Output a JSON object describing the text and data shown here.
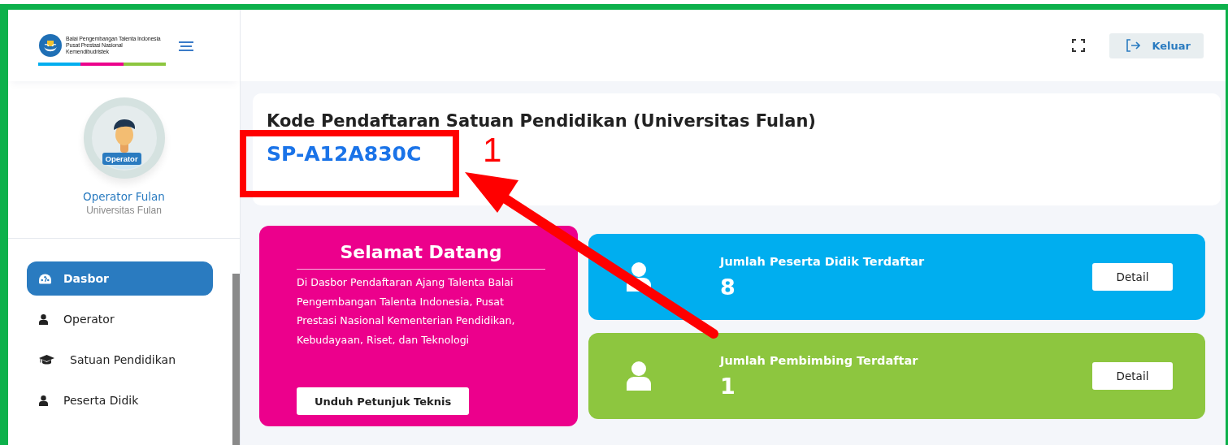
{
  "logo": {
    "lines": [
      "Balai Pengembangan Talenta Indonesia",
      "Pusat Prestasi Nasional",
      "Kemendibudristek"
    ]
  },
  "profile": {
    "badge": "Operator",
    "name": "Operator Fulan",
    "institution": "Universitas Fulan"
  },
  "nav": [
    {
      "label": "Dasbor",
      "kind": "dashboard",
      "selected": true
    },
    {
      "label": "Operator",
      "kind": "user",
      "selected": false
    },
    {
      "label": "Satuan Pendidikan",
      "kind": "cap",
      "selected": false
    },
    {
      "label": "Peserta Didik",
      "kind": "user",
      "selected": false
    }
  ],
  "header": {
    "logout": "Keluar"
  },
  "registration": {
    "title": "Kode Pendaftaran Satuan Pendidikan (Universitas Fulan)",
    "code": "SP-A12A830C"
  },
  "welcome": {
    "title": "Selamat Datang",
    "text": "Di Dasbor Pendaftaran Ajang Talenta Balai Pengembangan Talenta Indonesia, Pusat Prestasi Nasional Kementerian Pendidikan, Kebudayaan, Riset, dan Teknologi",
    "button": "Unduh Petunjuk Teknis"
  },
  "stats": [
    {
      "label": "Jumlah Peserta Didik Terdaftar",
      "value": "8",
      "color": "#00aeef",
      "button": "Detail"
    },
    {
      "label": "Jumlah Pembimbing Terdaftar",
      "value": "1",
      "color": "#8dc63f",
      "button": "Detail"
    }
  ],
  "annotation": {
    "label": "1"
  }
}
